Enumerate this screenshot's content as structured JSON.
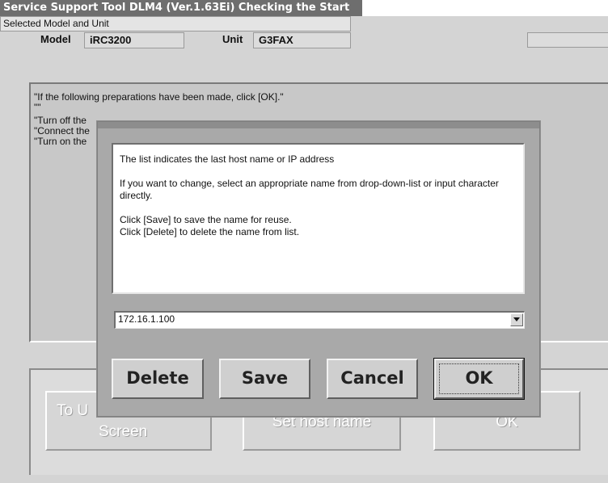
{
  "window": {
    "title": "Service Support Tool DLM4 (Ver.1.63Ei) Checking the Start"
  },
  "selected_model": {
    "header": "Selected Model and Unit",
    "model_label": "Model",
    "model_value": "iRC3200",
    "unit_label": "Unit",
    "unit_value": "G3FAX"
  },
  "background_message": {
    "lines": [
      "\"If the following preparations have been made, click [OK].\"",
      "\"\"",
      "\"Turn off the",
      "\"Connect the",
      "\"Turn on the"
    ]
  },
  "background_buttons": {
    "to_screen_line1": "To U",
    "to_screen_line2": "Screen",
    "set_host": "Set host name",
    "ok": "OK"
  },
  "dialog": {
    "info": {
      "line1": "The list indicates the last host name or IP address",
      "line2": "If you want to change, select an appropriate name from drop-down-list or input character directly.",
      "line3": "Click [Save] to save the name for reuse.",
      "line4": "Click [Delete] to delete the name from list."
    },
    "host_combo": {
      "value": "172.16.1.100",
      "dropdown_icon": "chevron-down-icon"
    },
    "buttons": {
      "delete": "Delete",
      "save": "Save",
      "cancel": "Cancel",
      "ok": "OK"
    }
  }
}
